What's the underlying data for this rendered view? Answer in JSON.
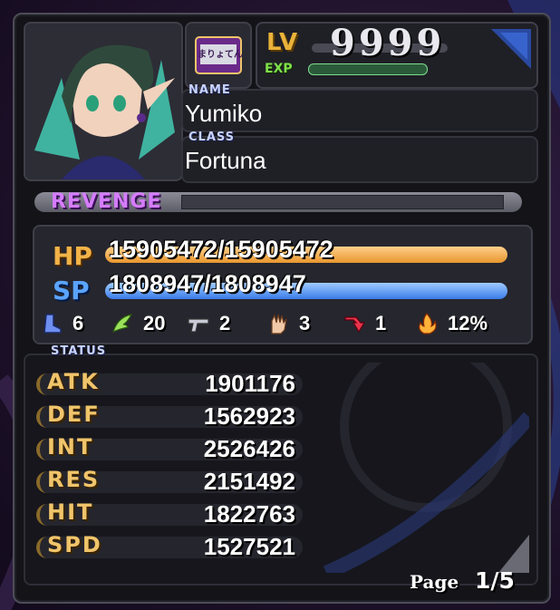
{
  "character": {
    "badge_text": "まりょてん",
    "lv_label": "LV",
    "lv_value": "9999",
    "exp_label": "EXP",
    "name_label": "NAME",
    "name": "Yumiko",
    "class_label": "CLASS",
    "class": "Fortuna"
  },
  "revenge": {
    "label": "REVENGE",
    "fill_fraction": 0.0
  },
  "vitals": {
    "hp_label": "HP",
    "hp_text": "15905472/15905472",
    "sp_label": "SP",
    "sp_text": "1808947/1808947"
  },
  "resistances": [
    {
      "icon": "boot-icon",
      "value": "6"
    },
    {
      "icon": "wing-icon",
      "value": "20"
    },
    {
      "icon": "gun-icon",
      "value": "2"
    },
    {
      "icon": "hand-icon",
      "value": "3"
    },
    {
      "icon": "counter-arrow-icon",
      "value": "1"
    },
    {
      "icon": "fire-icon",
      "value": "12%"
    }
  ],
  "status": {
    "title": "STATUS",
    "stats": [
      {
        "name": "ATK",
        "value": "1901176"
      },
      {
        "name": "DEF",
        "value": "1562923"
      },
      {
        "name": "INT",
        "value": "2526426"
      },
      {
        "name": "RES",
        "value": "2151492"
      },
      {
        "name": "HIT",
        "value": "1822763"
      },
      {
        "name": "SPD",
        "value": "1527521"
      }
    ]
  },
  "pagination": {
    "label": "Page",
    "current": "1/5"
  },
  "colors": {
    "hp": "#f2b347",
    "sp": "#5aa4ff",
    "revenge": "#d57cff",
    "stat_label": "#f0c46a",
    "lv": "#e9b23a",
    "exp": "#7fe04a"
  }
}
